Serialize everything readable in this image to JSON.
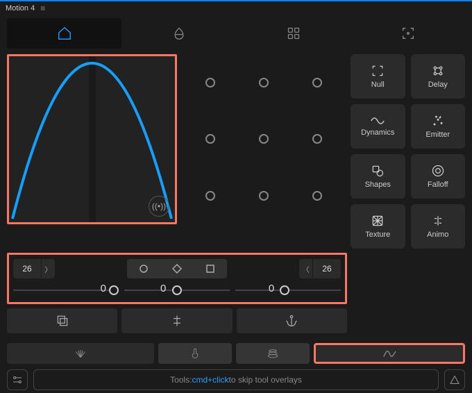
{
  "title": "Motion 4",
  "tabs": {
    "active_index": 0
  },
  "controls": {
    "left_value": "26",
    "right_value": "26",
    "slider_labels": [
      "0",
      "0",
      "0"
    ]
  },
  "palette": [
    {
      "label": "Null"
    },
    {
      "label": "Delay"
    },
    {
      "label": "Dynamics"
    },
    {
      "label": "Emitter"
    },
    {
      "label": "Shapes"
    },
    {
      "label": "Falloff"
    },
    {
      "label": "Texture"
    },
    {
      "label": "Animo"
    }
  ],
  "footer": {
    "hint_prefix": "Tools: ",
    "hint_kbd": "cmd+click",
    "hint_suffix": " to skip tool overlays"
  },
  "colors": {
    "accent": "#2d9cff",
    "highlight": "#fb7765"
  }
}
